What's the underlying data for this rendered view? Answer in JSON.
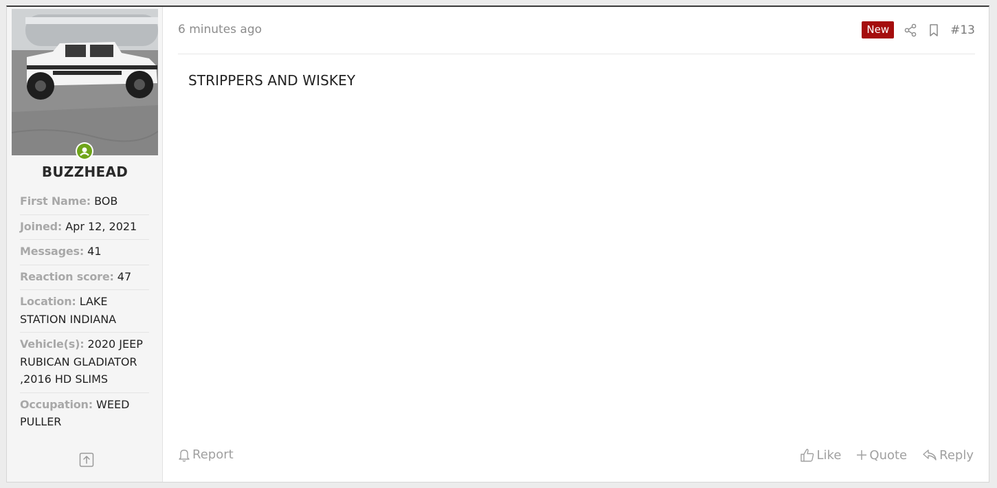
{
  "user": {
    "username": "BUZZHEAD",
    "avatar": "jeep-gladiator-photo",
    "status_icon": "online-user-icon",
    "status_color": "#6fa51a",
    "fields": [
      {
        "label": "First Name:",
        "value": "BOB"
      },
      {
        "label": "Joined:",
        "value": "Apr 12, 2021"
      },
      {
        "label": "Messages:",
        "value": "41"
      },
      {
        "label": "Reaction score:",
        "value": "47"
      },
      {
        "label": "Location:",
        "value": "LAKE STATION INDIANA"
      },
      {
        "label": "Vehicle(s):",
        "value": "2020 JEEP RUBICAN GLADIATOR ,2016 HD SLIMS"
      },
      {
        "label": "Occupation:",
        "value": "WEED PULLER"
      }
    ]
  },
  "post": {
    "time": "6 minutes ago",
    "badge": "New",
    "badge_color": "#a50d0d",
    "number": "#13",
    "body": "STRIPPERS AND WISKEY"
  },
  "actions": {
    "report": "Report",
    "like": "Like",
    "quote": "Quote",
    "reply": "Reply"
  }
}
